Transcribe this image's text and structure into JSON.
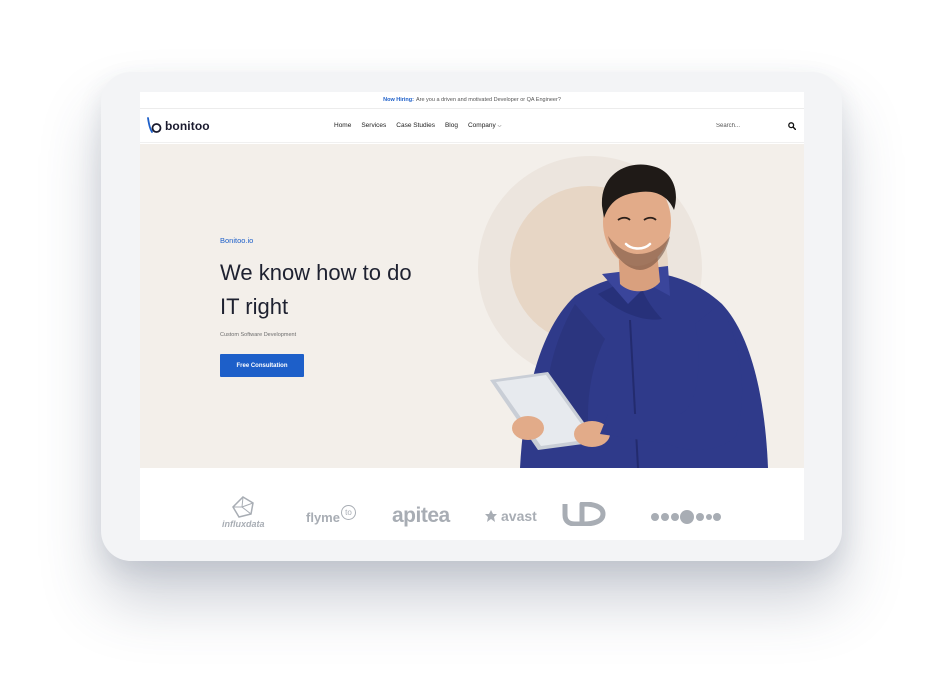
{
  "announcement": {
    "highlight": "Now Hiring:",
    "text": "Are you a driven and motivated Developer or QA Engineer?"
  },
  "brand": {
    "name": "bonitoo",
    "accent": "#1d5fc9"
  },
  "nav": {
    "items": [
      "Home",
      "Services",
      "Case Studies",
      "Blog",
      "Company"
    ],
    "search_placeholder": "Search..."
  },
  "hero": {
    "eyebrow": "Bonitoo.io",
    "headline_line1": "We know how to do",
    "headline_line2": "IT right",
    "subtitle": "Custom Software Development",
    "cta": "Free Consultation"
  },
  "clients": {
    "influxdata": "influxdata",
    "flyme_main": "flyme",
    "flyme_badge": "to",
    "apitea": "apitea",
    "avast": "avast",
    "ud": "UD"
  },
  "icons": [
    "search-icon",
    "chevron-down-icon"
  ]
}
